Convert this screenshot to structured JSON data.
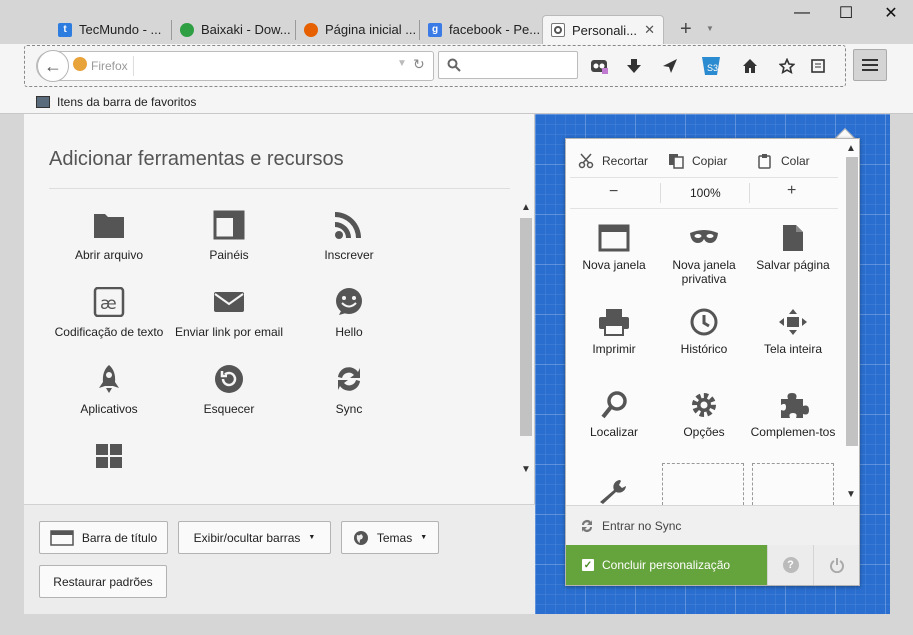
{
  "tabs": [
    {
      "label": "TecMundo - ...",
      "icon": "tecmundo-favicon",
      "color": "#2d7de0"
    },
    {
      "label": "Baixaki - Dow...",
      "icon": "baixaki-favicon",
      "color": "#2ea043"
    },
    {
      "label": "Página inicial ...",
      "icon": "firefox-favicon",
      "color": "#e66000"
    },
    {
      "label": "facebook - Pe...",
      "icon": "google-favicon",
      "color": "#3b7be6"
    },
    {
      "label": "Personali...",
      "icon": "customize-favicon",
      "color": "#666666"
    }
  ],
  "new_tab_symbol": "+",
  "window": {
    "minimize": "—",
    "maximize": "☐",
    "close": "✕"
  },
  "urlbar": {
    "identity": "Firefox",
    "value": ""
  },
  "bookmarks": {
    "label": "Itens da barra de favoritos"
  },
  "palette": {
    "title": "Adicionar ferramentas e recursos",
    "items": [
      {
        "label": "Abrir arquivo",
        "icon": "folder-icon"
      },
      {
        "label": "Painéis",
        "icon": "panels-icon"
      },
      {
        "label": "Inscrever",
        "icon": "rss-icon"
      },
      {
        "label": "Codificação de texto",
        "icon": "text-encoding-icon"
      },
      {
        "label": "Enviar link por email",
        "icon": "email-icon"
      },
      {
        "label": "Hello",
        "icon": "hello-icon"
      },
      {
        "label": "Aplicativos",
        "icon": "apps-icon"
      },
      {
        "label": "Esquecer",
        "icon": "forget-icon"
      },
      {
        "label": "Sync",
        "icon": "sync-icon"
      },
      {
        "label": "",
        "icon": "tile-view-icon"
      }
    ]
  },
  "bottom": {
    "titlebar": "Barra de título",
    "toolbars": "Exibir/ocultar barras",
    "themes": "Temas",
    "restore": "Restaurar padrões"
  },
  "menu": {
    "cut": "Recortar",
    "copy": "Copiar",
    "paste": "Colar",
    "zoom_out": "−",
    "zoom": "100%",
    "zoom_in": "+",
    "items": [
      {
        "label": "Nova janela",
        "icon": "new-window-icon"
      },
      {
        "label": "Nova janela privativa",
        "icon": "private-window-icon"
      },
      {
        "label": "Salvar página",
        "icon": "save-page-icon"
      },
      {
        "label": "Imprimir",
        "icon": "print-icon"
      },
      {
        "label": "Histórico",
        "icon": "history-icon"
      },
      {
        "label": "Tela inteira",
        "icon": "fullscreen-icon"
      },
      {
        "label": "Localizar",
        "icon": "find-icon"
      },
      {
        "label": "Opções",
        "icon": "options-icon"
      },
      {
        "label": "Complemen-tos",
        "icon": "addons-icon"
      }
    ],
    "sync": "Entrar no Sync",
    "done": "Concluir personalização"
  },
  "colors": {
    "blueprint": "#2a6fd0",
    "done_green": "#65a33c"
  }
}
